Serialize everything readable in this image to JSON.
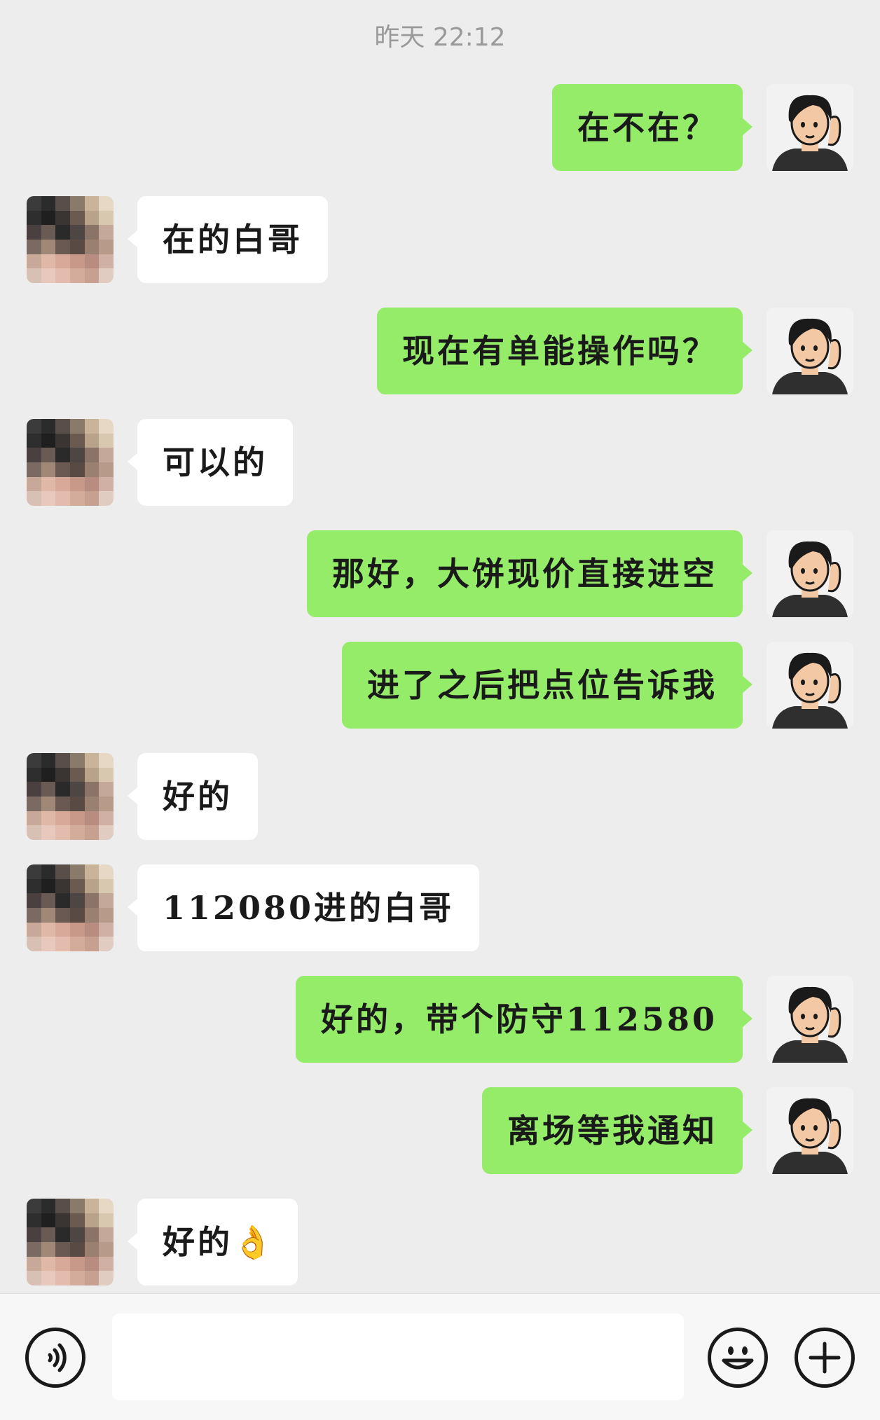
{
  "chat": {
    "timestamp": "昨天 22:12",
    "messages": [
      {
        "side": "out",
        "text": "在不在？"
      },
      {
        "side": "in",
        "text": "在的白哥"
      },
      {
        "side": "out",
        "text": "现在有单能操作吗？"
      },
      {
        "side": "in",
        "text": "可以的"
      },
      {
        "side": "out",
        "text": "那好，大饼现价直接进空"
      },
      {
        "side": "out",
        "text": "进了之后把点位告诉我"
      },
      {
        "side": "in",
        "text": "好的"
      },
      {
        "side": "in",
        "text": "112080进的白哥"
      },
      {
        "side": "out",
        "text": "好的，带个防守112580"
      },
      {
        "side": "out",
        "text": "离场等我通知"
      },
      {
        "side": "in",
        "text": "好的",
        "emoji": "👌"
      }
    ]
  },
  "input_bar": {
    "message_value": "",
    "icons": [
      "voice-icon",
      "emoji-icon",
      "plus-icon"
    ]
  },
  "colors": {
    "background": "#ededed",
    "outgoing_bubble": "#95ec69",
    "incoming_bubble": "#ffffff",
    "timestamp_text": "#9a9a9a"
  }
}
